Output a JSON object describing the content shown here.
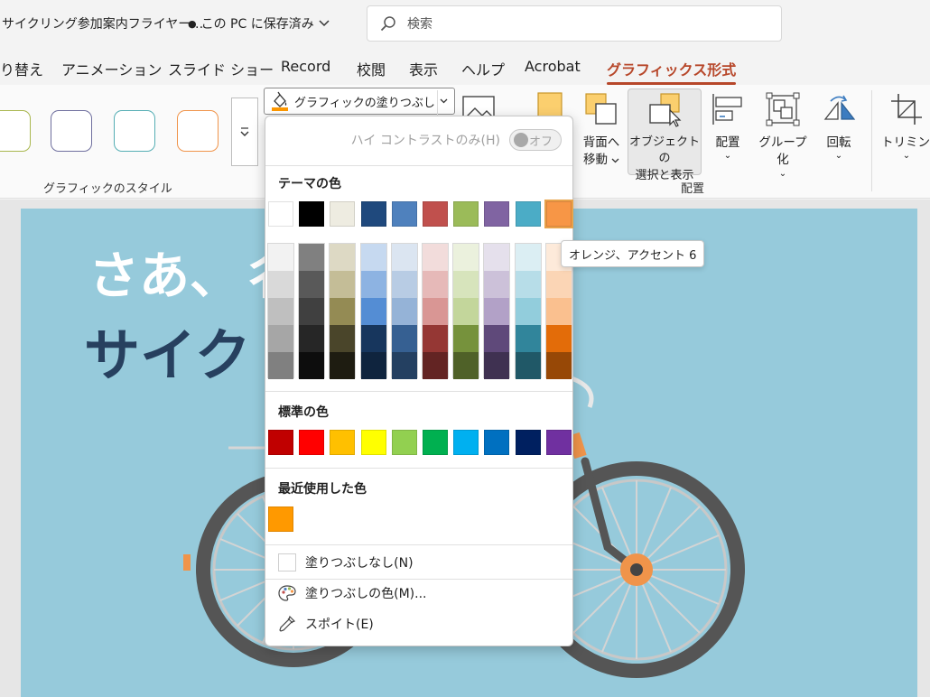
{
  "title_bar": {
    "document_title": "サイクリング参加案内フライヤー…",
    "save_status": "この PC に保存済み",
    "search_placeholder": "検索"
  },
  "tabs": [
    {
      "label": "り替え"
    },
    {
      "label": "アニメーション"
    },
    {
      "label": "スライド ショー"
    },
    {
      "label": "Record"
    },
    {
      "label": "校閲"
    },
    {
      "label": "表示"
    },
    {
      "label": "ヘルプ"
    },
    {
      "label": "Acrobat"
    },
    {
      "label": "グラフィックス形式",
      "active": true
    }
  ],
  "ribbon": {
    "styles_group_label": "グラフィックのスタイル",
    "fill_button_label": "グラフィックの塗りつぶし",
    "send_backward_line1": "背面へ",
    "send_backward_line2": "移動",
    "selection_pane_line1": "オブジェクトの",
    "selection_pane_line2": "選択と表示",
    "align_label": "配置",
    "group_label": "グループ化",
    "rotate_label": "回転",
    "crop_label": "トリミング",
    "arrange_group_label": "配置",
    "style_swatch_colors": [
      "#a9b74e",
      "#6f6f9e",
      "#55aeb4",
      "#f0944a"
    ]
  },
  "slide": {
    "headline_line1": "さあ、彳",
    "headline_line2": "サイク",
    "background_color": "#96cadb"
  },
  "dropdown": {
    "high_contrast_label": "ハイ コントラストのみ(H)",
    "high_contrast_toggle": "オフ",
    "theme_colors_heading": "テーマの色",
    "theme_colors": [
      "#ffffff",
      "#000000",
      "#eeece1",
      "#1f497d",
      "#4f81bd",
      "#c0504d",
      "#9bbb59",
      "#8064a2",
      "#4bacc6",
      "#f79646"
    ],
    "theme_shades": [
      [
        "#f2f2f2",
        "#d9d9d9",
        "#bfbfbf",
        "#a6a6a6",
        "#808080"
      ],
      [
        "#808080",
        "#595959",
        "#404040",
        "#262626",
        "#0d0d0d"
      ],
      [
        "#ddd9c4",
        "#c4bd97",
        "#948b54",
        "#4a452a",
        "#1e1c11"
      ],
      [
        "#c6d9f0",
        "#8db3e2",
        "#548dd4",
        "#17365d",
        "#0f243e"
      ],
      [
        "#dbe5f1",
        "#b8cce4",
        "#95b3d7",
        "#366092",
        "#244061"
      ],
      [
        "#f2dcdb",
        "#e6b9b8",
        "#d99694",
        "#953734",
        "#632423"
      ],
      [
        "#ebf1dd",
        "#d7e4bc",
        "#c3d69b",
        "#76923c",
        "#4f6128"
      ],
      [
        "#e5e0ec",
        "#ccc1d9",
        "#b2a1c7",
        "#5f497a",
        "#3f3151"
      ],
      [
        "#dbeef3",
        "#b7dde8",
        "#92cddc",
        "#31859b",
        "#205867"
      ],
      [
        "#fdeada",
        "#fbd5b5",
        "#fac08f",
        "#e36c09",
        "#974806"
      ]
    ],
    "standard_colors_heading": "標準の色",
    "standard_colors": [
      "#c00000",
      "#ff0000",
      "#ffc000",
      "#ffff00",
      "#92d050",
      "#00b050",
      "#00b0f0",
      "#0070c0",
      "#002060",
      "#7030a0"
    ],
    "recent_colors_heading": "最近使用した色",
    "recent_colors": [
      "#ff9900"
    ],
    "no_fill_label": "塗りつぶしなし(N)",
    "more_colors_label": "塗りつぶしの色(M)...",
    "eyedropper_label": "スポイト(E)"
  },
  "tooltip": {
    "text": "オレンジ、アクセント 6"
  }
}
